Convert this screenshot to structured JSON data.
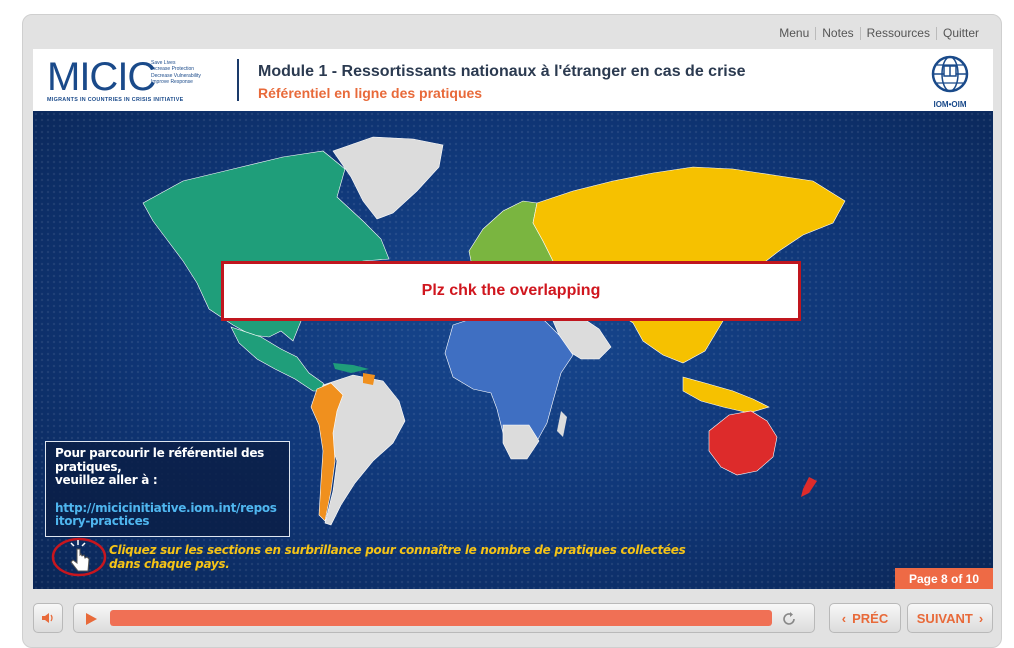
{
  "topnav": [
    "Menu",
    "Notes",
    "Ressources",
    "Quitter"
  ],
  "header": {
    "logo_text": "MICIC",
    "logo_tagline": [
      "Save Lives",
      "Increase Protection",
      "Decrease Vulnerability",
      "Improve Response"
    ],
    "logo_subtitle": "MIGRANTS IN COUNTRIES IN CRISIS INITIATIVE",
    "title": "Module 1 - Ressortissants nationaux à l'étranger en cas de crise",
    "subtitle": "Référentiel en ligne des pratiques",
    "partner_logo_text": "IOM•OIM"
  },
  "overlay": {
    "text": "Plz chk the overlapping"
  },
  "info": {
    "lines": [
      "Pour parcourir le référentiel des pratiques,",
      "veuillez aller à :"
    ],
    "link": "http://micicinitiative.iom.int/repository-practices"
  },
  "instruction": {
    "line1": "Cliquez sur les sections en surbrillance pour connaître le nombre de pratiques collectées",
    "line2": "dans chaque pays."
  },
  "page_indicator": "Page 8 of 10",
  "controls": {
    "prev_label": "PRÉC",
    "next_label": "SUIVANT",
    "progress": 1.0
  },
  "colors": {
    "americas_north": "#1f9e7a",
    "latam": "#f0901e",
    "europe": "#7ab540",
    "asia": "#f6c100",
    "africa": "#3f6fc2",
    "oceania": "#dd2b2b",
    "unhighlighted": "#dcdcdc"
  }
}
